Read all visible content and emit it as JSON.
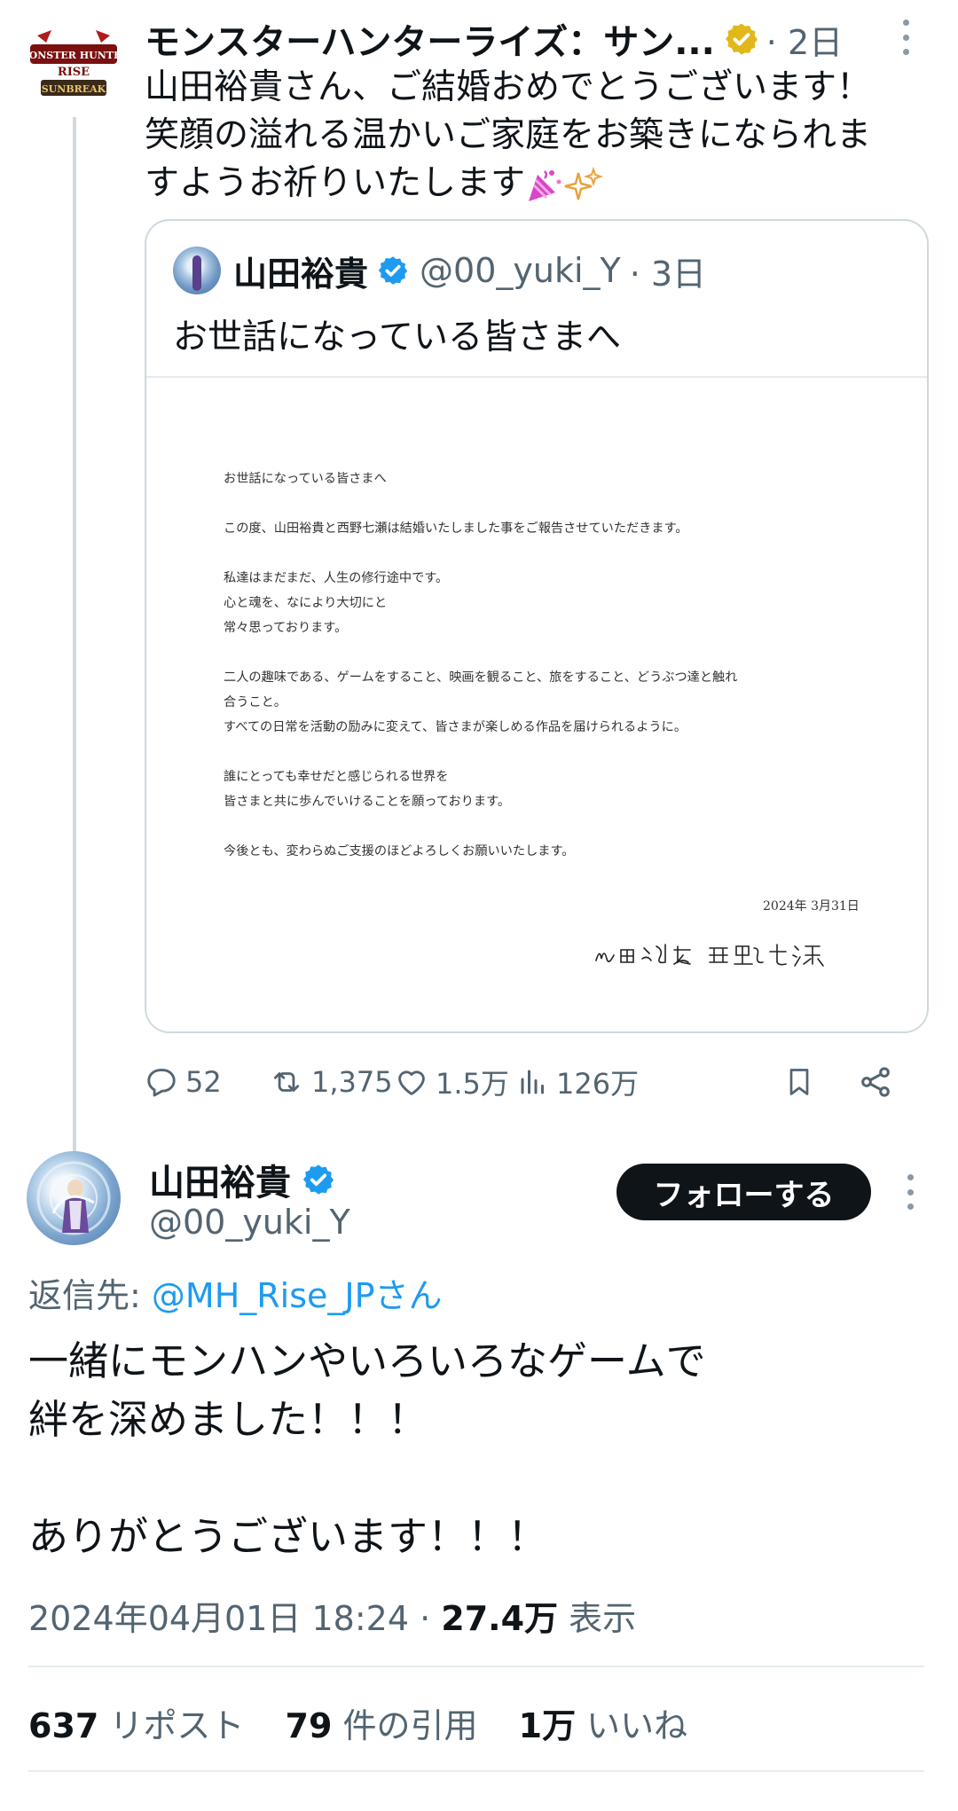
{
  "parent_tweet": {
    "author_name": "モンスターハンターライズ：サン...",
    "time": "· 2日",
    "text": "山田裕貴さん、ご結婚おめでとうございます！\n笑顔の溢れる温かいご家庭をお築きになられま\nすようお祈りいたします",
    "logo_lines": [
      "MONSTER HUNTER",
      "RISE",
      "SUNBREAK"
    ],
    "quote": {
      "author_name": "山田裕貴",
      "handle": "@00_yuki_Y",
      "time": "· 3日",
      "text": "お世話になっている皆さまへ",
      "letter": {
        "lines": [
          "お世話になっている皆さまへ",
          "",
          "この度、山田裕貴と西野七瀬は結婚いたしました事をご報告させていただきます。",
          "",
          "私達はまだまだ、人生の修行途中です。",
          "心と魂を、なにより大切にと",
          "常々思っております。",
          "",
          "二人の趣味である、ゲームをすること、映画を観ること、旅をすること、どうぶつ達と触れ",
          "合うこと。",
          "すべての日常を活動の励みに変えて、皆さまが楽しめる作品を届けられるように。",
          "",
          "誰にとっても幸せだと感じられる世界を",
          "皆さまと共に歩んでいけることを願っております。",
          "",
          "今後とも、変わらぬご支援のほどよろしくお願いいたします。"
        ],
        "date": "2024年 3月31日",
        "signature": "山田裕貴　西野七瀬"
      }
    },
    "actions": {
      "replies": "52",
      "reposts": "1,375",
      "likes": "1.5万",
      "views": "126万"
    }
  },
  "main_tweet": {
    "author_name": "山田裕貴",
    "handle": "@00_yuki_Y",
    "follow_label": "フォローする",
    "reply_prefix": "返信先:",
    "reply_target": "@MH_Rise_JPさん",
    "text": "一緒にモンハンやいろいろなゲームで\n絆を深めました！！！\n\nありがとうございます！！！",
    "timestamp": "2024年04月01日 18:24 ·",
    "views_count": "27.4万",
    "views_label": "表示",
    "stats": [
      {
        "count": "637",
        "label": "リポスト"
      },
      {
        "count": "79",
        "label": "件の引用"
      },
      {
        "count": "1万",
        "label": "いいね"
      }
    ]
  },
  "colors": {
    "text": "#0f1419",
    "secondary": "#536471",
    "link": "#1d9bf0",
    "border": "#cfd9de",
    "gold_badge": "#e2b719",
    "follow_button": "#0f1419"
  }
}
